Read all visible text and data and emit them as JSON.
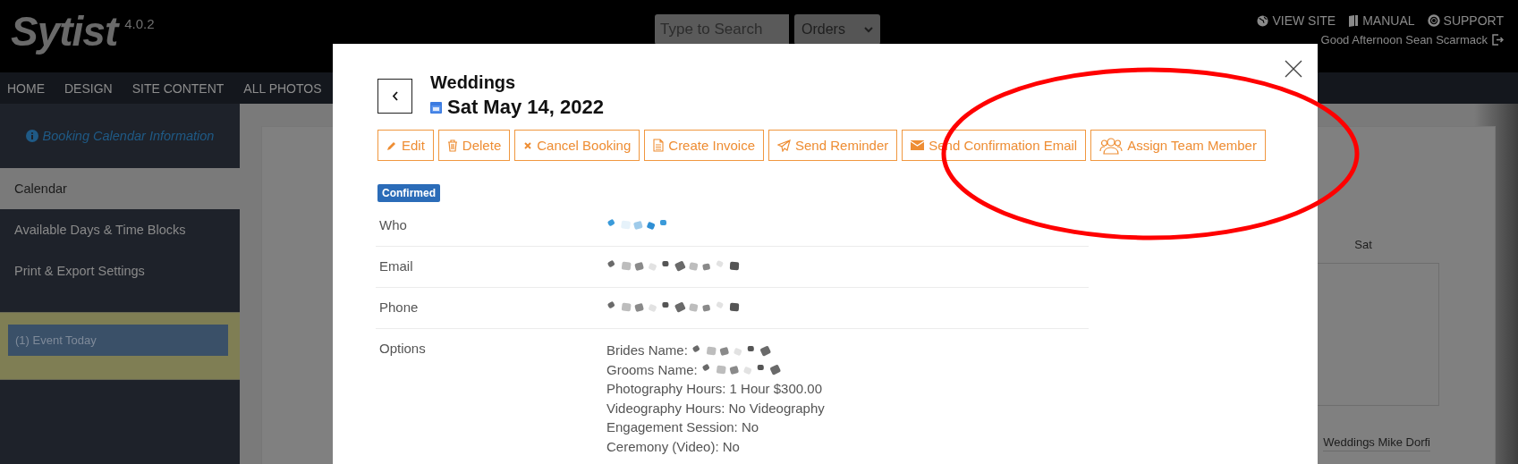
{
  "app": {
    "logo": "Sytist",
    "version": "4.0.2"
  },
  "search": {
    "placeholder": "Type to Search"
  },
  "search_scope": {
    "value": "Orders"
  },
  "top_links": [
    "VIEW SITE",
    "MANUAL",
    "SUPPORT"
  ],
  "greeting": "Good Afternoon Sean Scarmack",
  "nav": [
    "HOME",
    "DESIGN",
    "SITE CONTENT",
    "ALL PHOTOS"
  ],
  "sidebar": {
    "heading": "Booking Calendar Information",
    "items": [
      {
        "label": "Calendar",
        "selected": true
      },
      {
        "label": "Available Days & Time Blocks",
        "selected": false
      },
      {
        "label": "Print & Export Settings",
        "selected": false
      }
    ],
    "notice": "(1) Event Today"
  },
  "calendar": {
    "day_header": "Sat",
    "event": "Weddings Mike Dorfi"
  },
  "modal": {
    "title": "Weddings",
    "date": "Sat May 14, 2022",
    "actions": [
      "Edit",
      "Delete",
      "Cancel Booking",
      "Create Invoice",
      "Send Reminder",
      "Send Confirmation Email",
      "Assign Team Member"
    ],
    "status": "Confirmed",
    "details": [
      {
        "label": "Who",
        "kind": "redacted_link"
      },
      {
        "label": "Email",
        "kind": "redacted"
      },
      {
        "label": "Phone",
        "kind": "redacted"
      },
      {
        "label": "Options",
        "kind": "list",
        "lines": [
          {
            "text": "Brides Name:",
            "redacted": true
          },
          {
            "text": "Grooms Name:",
            "redacted": true
          },
          {
            "text": "Photography Hours: 1 Hour $300.00",
            "redacted": false
          },
          {
            "text": "Videography Hours: No Videography",
            "redacted": false
          },
          {
            "text": "Engagement Session: No",
            "redacted": false
          },
          {
            "text": "Ceremony (Video): No",
            "redacted": false
          }
        ]
      }
    ]
  }
}
